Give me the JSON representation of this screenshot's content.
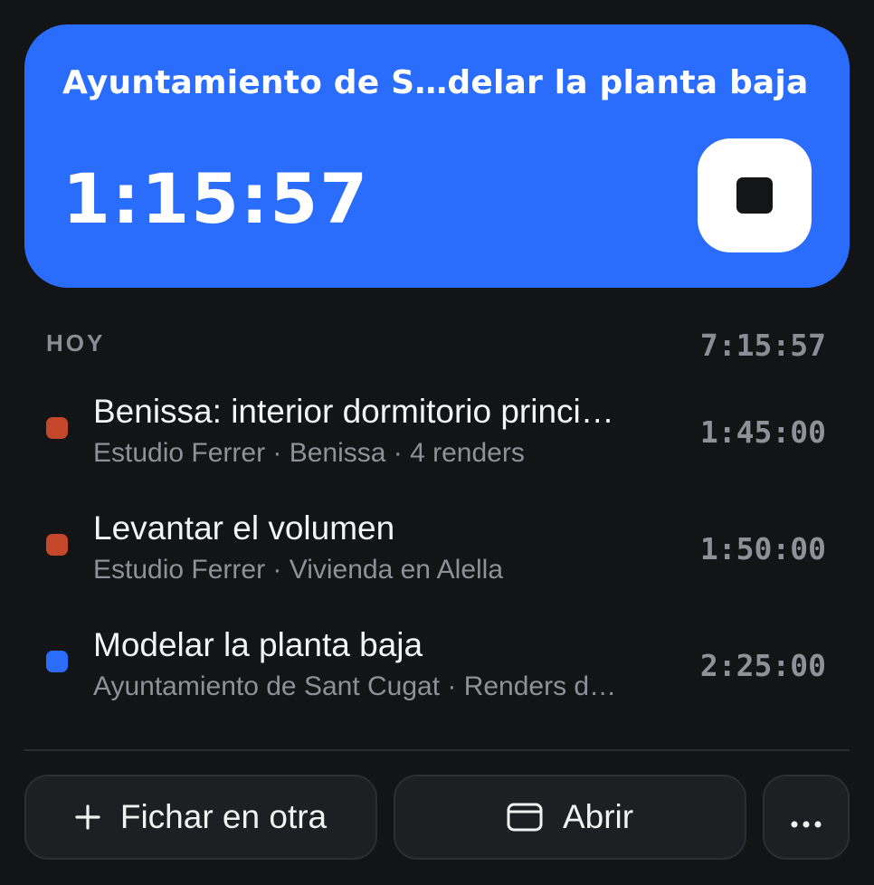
{
  "timer": {
    "title": "Ayuntamiento de S…delar la planta baja",
    "elapsed": "1:15:57",
    "accent_color": "#2a6cfb"
  },
  "section": {
    "label": "HOY",
    "total": "7:15:57"
  },
  "entries": [
    {
      "title": "Benissa: interior dormitorio princi…",
      "meta": "Estudio Ferrer · Benissa · 4 renders",
      "duration": "1:45:00",
      "color": "#c4472b"
    },
    {
      "title": "Levantar el volumen",
      "meta": "Estudio Ferrer · Vivienda en Alella",
      "duration": "1:50:00",
      "color": "#c4472b"
    },
    {
      "title": "Modelar la planta baja",
      "meta": "Ayuntamiento de Sant Cugat · Renders d…",
      "duration": "2:25:00",
      "color": "#2a6cfb"
    }
  ],
  "actions": {
    "new_label": "Fichar en otra",
    "new_icon": "plus-icon",
    "open_label": "Abrir",
    "open_icon": "window-icon",
    "more_icon": "ellipsis-icon"
  }
}
